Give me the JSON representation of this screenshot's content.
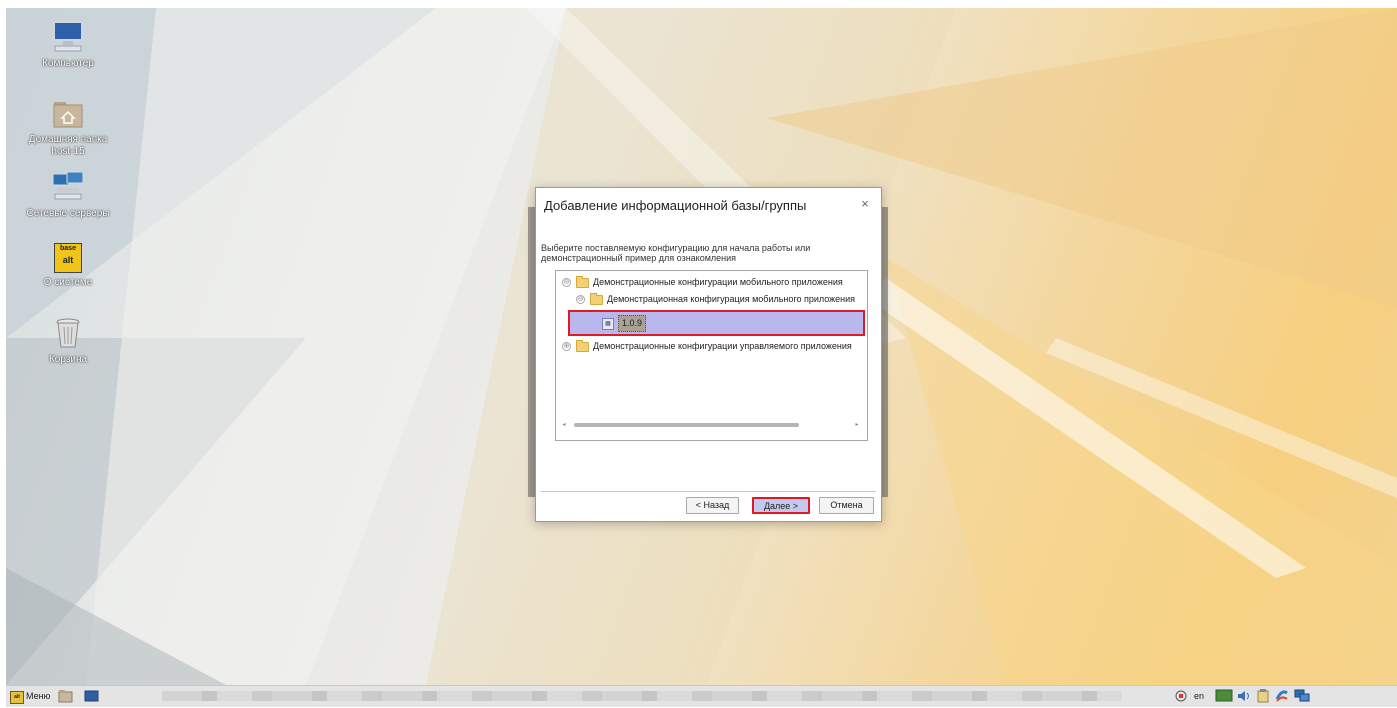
{
  "desktop": {
    "icons": [
      {
        "label": "Компьютер",
        "icon": "computer-icon"
      },
      {
        "label": "Домашняя папка host-15",
        "icon": "home-folder-icon"
      },
      {
        "label": "Сетевые серверы",
        "icon": "network-servers-icon"
      },
      {
        "label": "О системе",
        "icon": "about-system-icon",
        "badge_top": "base",
        "badge_bottom": "alt"
      },
      {
        "label": "Корзина",
        "icon": "trash-icon"
      }
    ]
  },
  "dialog": {
    "title": "Добавление информационной базы/группы",
    "close_glyph": "×",
    "prompt": "Выберите поставляемую конфигурацию для начала работы или демонстрационный пример для ознакомления",
    "tree": [
      {
        "label": "Демонстрационные конфигурации мобильного приложения",
        "expander": "⊖"
      },
      {
        "label": "Демонстрационная конфигурация мобильного приложения",
        "expander": "⊖"
      },
      {
        "label": "1.0.9",
        "selected": true
      },
      {
        "label": "Демонстрационные конфигурации управляемого приложения",
        "expander": "⊕"
      }
    ],
    "scroll_left": "◂",
    "scroll_right": "▸",
    "buttons": {
      "back": "< Назад",
      "next": "Далее >",
      "cancel": "Отмена"
    },
    "highlight_color": "#e01a22"
  },
  "taskbar": {
    "menu_label": "Меню",
    "menu_logo": "alt",
    "language": "en"
  }
}
